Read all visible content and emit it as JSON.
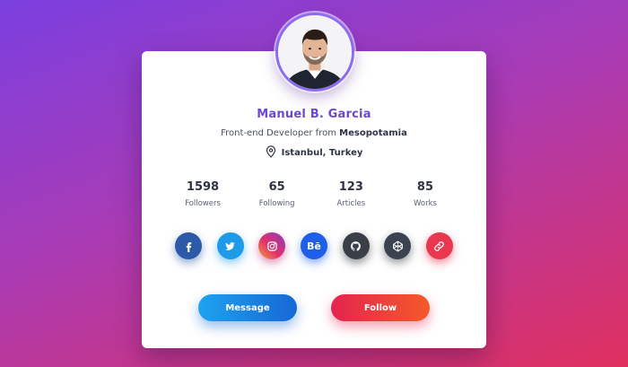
{
  "profile": {
    "name": "Manuel B. Garcia",
    "role_prefix": "Front-end Developer from",
    "role_place": "Mesopotamia",
    "location": "Istanbul, Turkey"
  },
  "stats": [
    {
      "value": "1598",
      "label": "Followers"
    },
    {
      "value": "65",
      "label": "Following"
    },
    {
      "value": "123",
      "label": "Articles"
    },
    {
      "value": "85",
      "label": "Works"
    }
  ],
  "socials": [
    {
      "icon": "facebook-icon",
      "color": "#2c5aa8"
    },
    {
      "icon": "twitter-icon",
      "color": "#1d9be8"
    },
    {
      "icon": "instagram-icon",
      "color": "#c13584"
    },
    {
      "icon": "behance-icon",
      "label": "Bē",
      "color": "#1f5ee8"
    },
    {
      "icon": "github-icon",
      "color": "#3a3f47"
    },
    {
      "icon": "codepen-icon",
      "color": "#3b4350"
    },
    {
      "icon": "link-icon",
      "color": "#e8374f"
    }
  ],
  "buttons": {
    "message_label": "Message",
    "follow_label": "Follow"
  },
  "colors": {
    "accent": "#6b47d6",
    "message_gradient": [
      "#1fa2f0",
      "#1668d4"
    ],
    "follow_gradient": [
      "#e4244f",
      "#f45a2a"
    ]
  }
}
